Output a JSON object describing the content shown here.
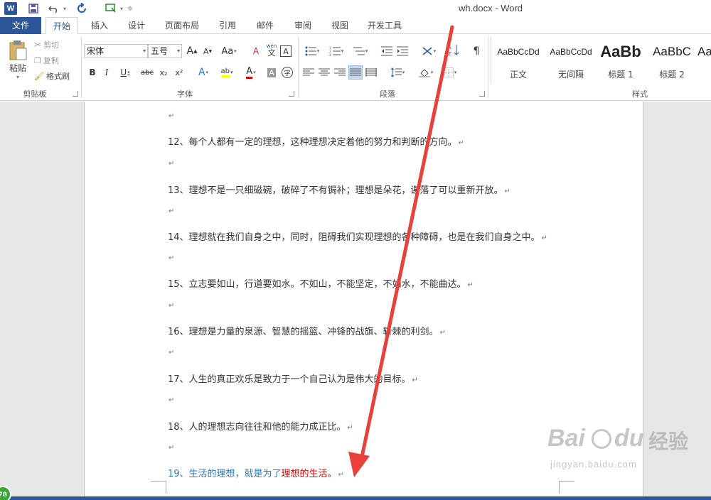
{
  "app": {
    "logo": "W",
    "title": "wh.docx - Word"
  },
  "tabs": [
    "文件",
    "开始",
    "插入",
    "设计",
    "页面布局",
    "引用",
    "邮件",
    "审阅",
    "视图",
    "开发工具"
  ],
  "ribbon": {
    "clipboard": {
      "paste": "粘贴",
      "cut": "剪切",
      "copy": "复制",
      "format_painter": "格式刷",
      "label": "剪贴板"
    },
    "font": {
      "name": "宋体",
      "size": "五号",
      "label": "字体",
      "bold": "B",
      "italic": "I",
      "underline": "U",
      "strike": "abc",
      "sub": "x₂",
      "sup": "x²",
      "grow": "A",
      "shrink": "A",
      "case": "Aa",
      "clear": "A",
      "phonetic": "wén",
      "phonetic_char": "文",
      "border_char": "A",
      "effects": "A",
      "highlight": "ab",
      "font_color": "A",
      "shading": "A",
      "enclose": "字"
    },
    "paragraph": {
      "label": "段落"
    },
    "styles": {
      "label": "样式",
      "items": [
        {
          "sample": "AaBbCcDd",
          "name": "正文"
        },
        {
          "sample": "AaBbCcDd",
          "name": "无间隔"
        },
        {
          "sample": "AaBb",
          "name": "标题 1"
        },
        {
          "sample": "AaBbC",
          "name": "标题 2"
        },
        {
          "sample": "Aa",
          "name": ""
        }
      ]
    }
  },
  "document": {
    "paragraphs": [
      "12、每个人都有一定的理想，这种理想决定着他的努力和判断的方向。",
      "13、理想不是一只细磁碗，破碎了不有锔补；理想是朵花，谢落了可以重新开放。",
      "14、理想就在我们自身之中，同时，阻碍我们实现理想的各种障碍，也是在我们自身之中。",
      "15、立志要如山，行道要如水。不如山，不能坚定，不如水，不能曲达。",
      "16、理想是力量的泉源、智慧的摇篮、冲锋的战旗、斩棘的利剑。",
      "17、人生的真正欢乐是致力于一个自己认为是伟大的目标。",
      "18、人的理想志向往往和他的能力成正比。"
    ],
    "last": {
      "blue": "19、生活的理想，就是为了",
      "red": "理想的生活。"
    },
    "para_mark": "↵"
  },
  "status": {
    "badge": "78"
  },
  "watermark": {
    "brand": "Bai",
    "brand2": "du",
    "cn": "经验",
    "url": "jingyan.baidu.com"
  },
  "colors": {
    "accent": "#2b579a",
    "arrow": "#e8403c",
    "blue_text": "#2e75b6",
    "red_text": "#e00000"
  }
}
